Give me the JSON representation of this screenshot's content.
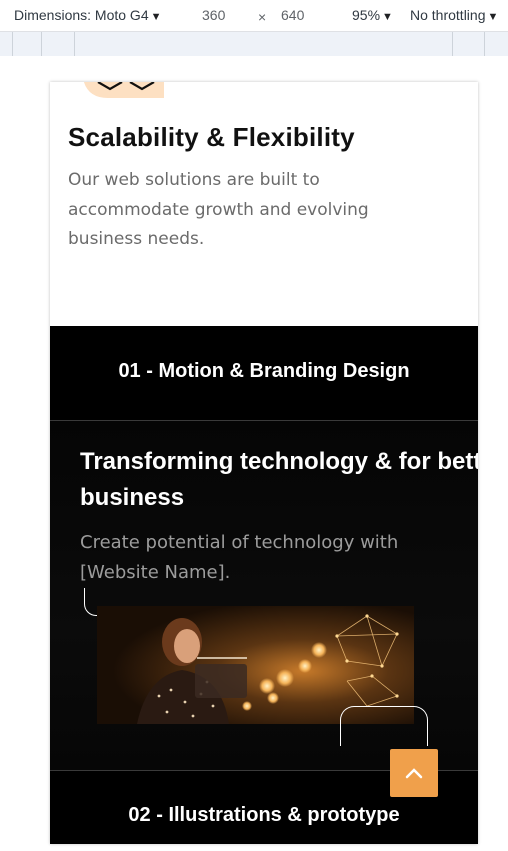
{
  "devtools": {
    "dimensions_label": "Dimensions: Moto G4",
    "width": "360",
    "times": "×",
    "height": "640",
    "zoom": "95%",
    "throttling": "No throttling"
  },
  "feature_card": {
    "title": "Scalability & Flexibility",
    "text": "Our web solutions are built to accommodate growth and evolving business needs.",
    "icon": "chevrons-icon",
    "icon_bg": "#fde0c2"
  },
  "accordion": {
    "items": [
      {
        "label": "01 - Motion & Branding Design"
      },
      {
        "label": "02 - Illustrations & prototype"
      }
    ]
  },
  "panel": {
    "title_line1": "Transforming technology & for better",
    "title_line2": "business",
    "text": "Create potential of technology with [Website Name]."
  },
  "colors": {
    "accent": "#f0a04b",
    "dark_bg": "#000000"
  }
}
